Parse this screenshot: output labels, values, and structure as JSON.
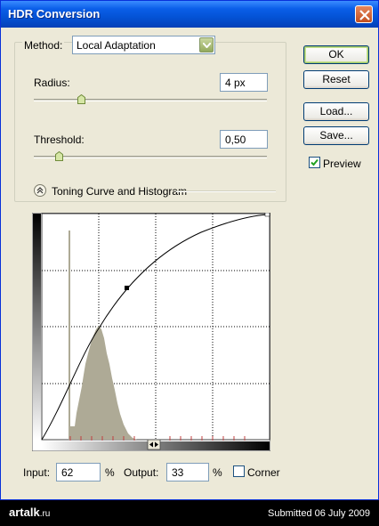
{
  "window": {
    "title": "HDR Conversion"
  },
  "method": {
    "label": "Method:",
    "value": "Local Adaptation"
  },
  "radius": {
    "label": "Radius:",
    "value": "4 px",
    "slider_fraction": 0.2
  },
  "threshold": {
    "label": "Threshold:",
    "value": "0,50",
    "slider_fraction": 0.1
  },
  "toning": {
    "label": "Toning Curve and Histogram"
  },
  "buttons": {
    "ok": "OK",
    "reset": "Reset",
    "load": "Load...",
    "save": "Save..."
  },
  "preview": {
    "label": "Preview",
    "checked": true
  },
  "bottom": {
    "input_label": "Input:",
    "input_value": "62",
    "input_unit": "%",
    "output_label": "Output:",
    "output_value": "33",
    "output_unit": "%",
    "corner_label": "Corner",
    "corner_checked": false
  },
  "footer": {
    "logo_text": "artalk",
    "logo_domain": ".ru",
    "submitted": "Submitted 06 July 2009"
  },
  "colors": {
    "title_bar": "#0a5ee8",
    "histogram": "#aeaa96",
    "window_bg": "#ece9d8"
  }
}
